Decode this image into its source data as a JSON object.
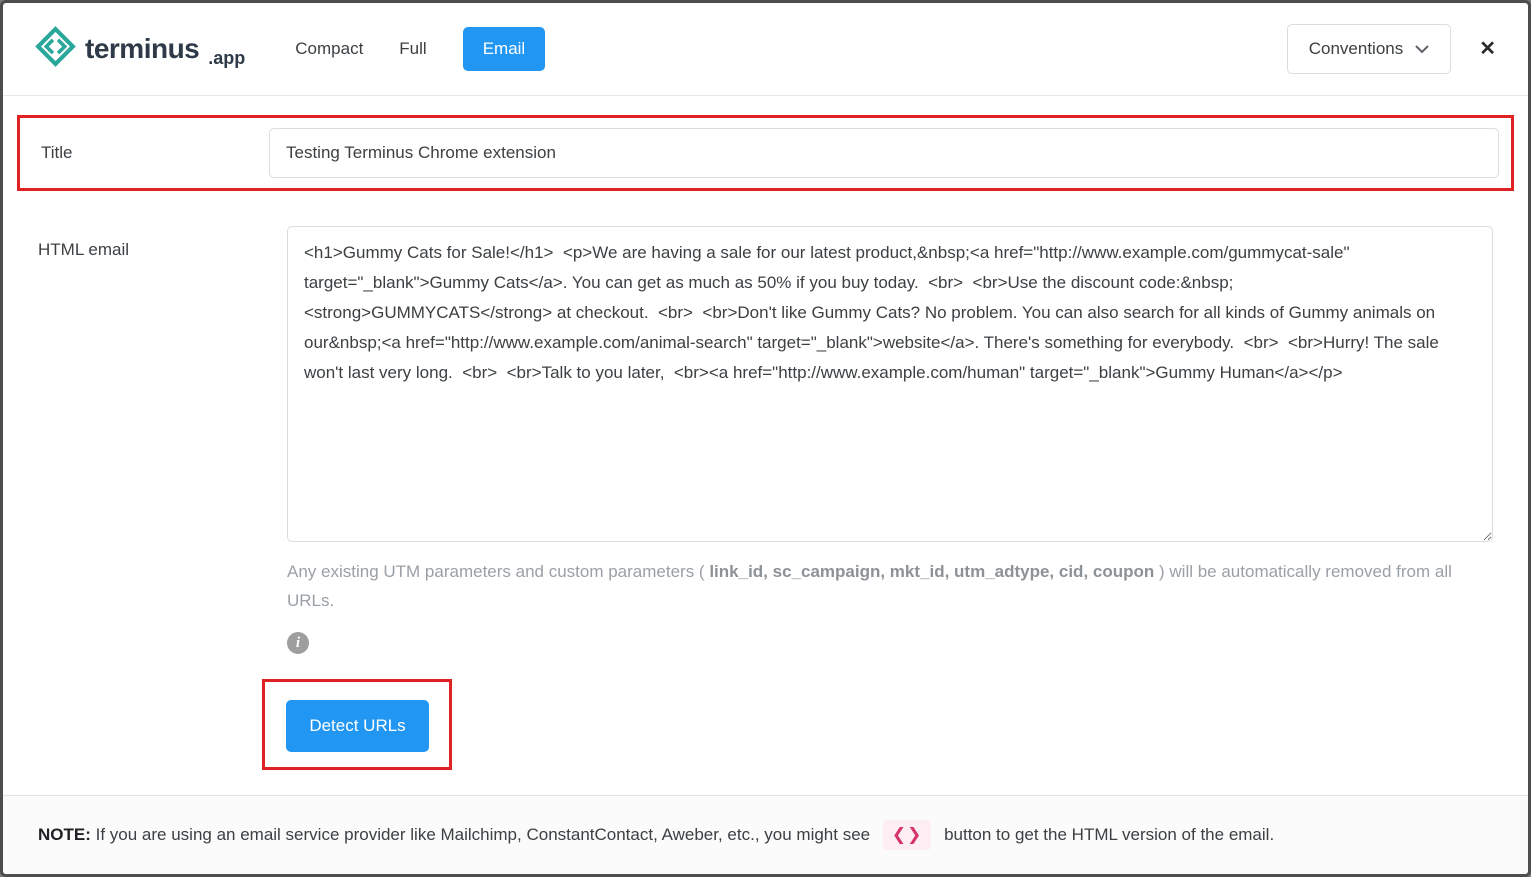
{
  "header": {
    "logo": {
      "brand": "terminus",
      "suffix": ".app"
    },
    "tabs": [
      {
        "label": "Compact",
        "active": false
      },
      {
        "label": "Full",
        "active": false
      },
      {
        "label": "Email",
        "active": true
      }
    ],
    "conventions_label": "Conventions",
    "close_icon": "✕"
  },
  "form": {
    "title": {
      "label": "Title",
      "value": "Testing Terminus Chrome extension"
    },
    "html_email": {
      "label": "HTML email",
      "value": "<h1>Gummy Cats for Sale!</h1>  <p>We are having a sale for our latest product,&nbsp;<a href=\"http://www.example.com/gummycat-sale\" target=\"_blank\">Gummy Cats</a>. You can get as much as 50% if you buy today.  <br>  <br>Use the discount code:&nbsp; <strong>GUMMYCATS</strong> at checkout.  <br>  <br>Don't like Gummy Cats? No problem. You can also search for all kinds of Gummy animals on our&nbsp;<a href=\"http://www.example.com/animal-search\" target=\"_blank\">website</a>. There's something for everybody.  <br>  <br>Hurry! The sale won't last very long.  <br>  <br>Talk to you later,  <br><a href=\"http://www.example.com/human\" target=\"_blank\">Gummy Human</a></p>"
    },
    "helper": {
      "prefix": "Any existing UTM parameters and custom parameters ( ",
      "params": "link_id, sc_campaign, mkt_id, utm_adtype, cid, coupon",
      "suffix": " ) will be automatically removed from all URLs."
    },
    "info_icon_glyph": "i",
    "detect_button_label": "Detect URLs"
  },
  "footer": {
    "note_label": "NOTE:",
    "note_text_before": " If you are using an email service provider like Mailchimp, ConstantContact, Aweber, etc., you might see ",
    "code_icon_glyph": "❮❯",
    "note_text_after": " button to get the HTML version of the email."
  },
  "colors": {
    "accent_blue": "#2196f3",
    "annotation_red": "#e02222",
    "brand_teal": "#2aa79b",
    "code_pink": "#d6336c"
  }
}
